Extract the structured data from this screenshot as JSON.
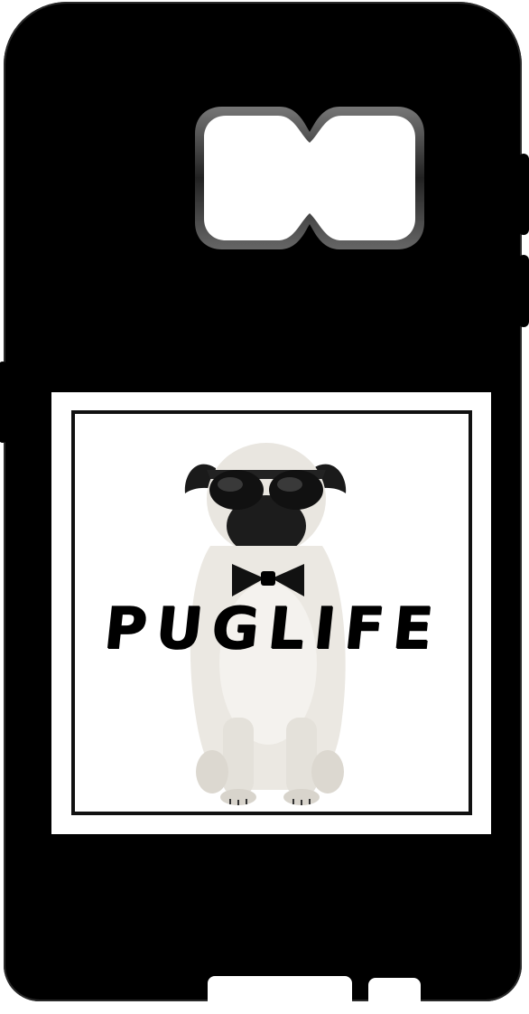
{
  "product": {
    "title_text": "PUGLIFE",
    "case_color": "#000000",
    "print_background": "#ffffff"
  },
  "icons": {
    "camera": "camera-cutout-icon",
    "subject": "pug-illustration"
  }
}
